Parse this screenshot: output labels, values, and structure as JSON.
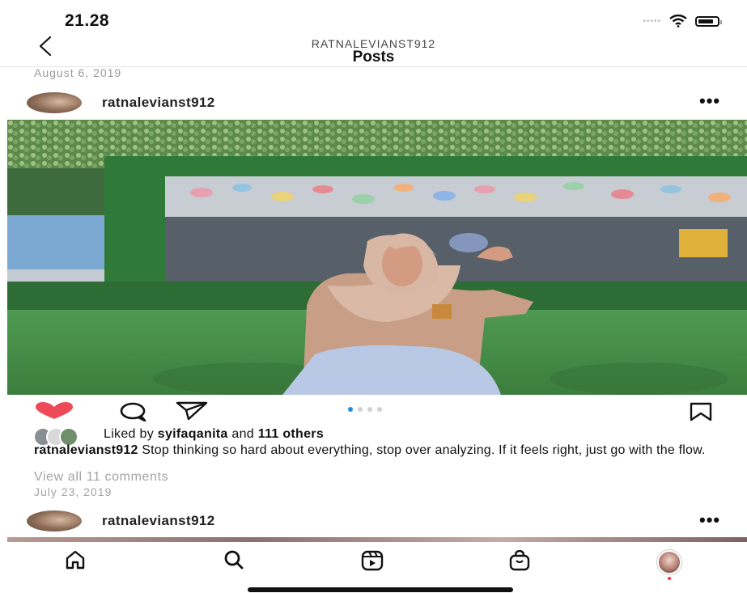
{
  "status_bar": {
    "time": "21.28"
  },
  "header": {
    "username": "RATNALEVIANST912",
    "title": "Posts"
  },
  "post_previous": {
    "date": "August 6, 2019"
  },
  "post": {
    "username": "ratnalevianst912",
    "more_label": "•••",
    "liked_by_prefix": "Liked by",
    "liked_by_user": "syifaqanita",
    "liked_by_middle": "and",
    "liked_by_others": "111 others",
    "caption_user": "ratnalevianst912",
    "caption_text": "Stop thinking so hard about everything, stop over analyzing. If it feels right,  just go with the flow.",
    "view_comments": "View all 11 comments",
    "date": "July 23, 2019",
    "carousel": {
      "total": 4,
      "active": 1
    }
  },
  "next_post": {
    "username": "ratnalevianst912",
    "more_label": "•••"
  },
  "bottom_nav": [
    "home",
    "search",
    "reels",
    "shop",
    "profile"
  ],
  "colors": {
    "heart": "#ed4956",
    "dot_active": "#1e8fe6",
    "notif_dot": "#ff3040"
  }
}
